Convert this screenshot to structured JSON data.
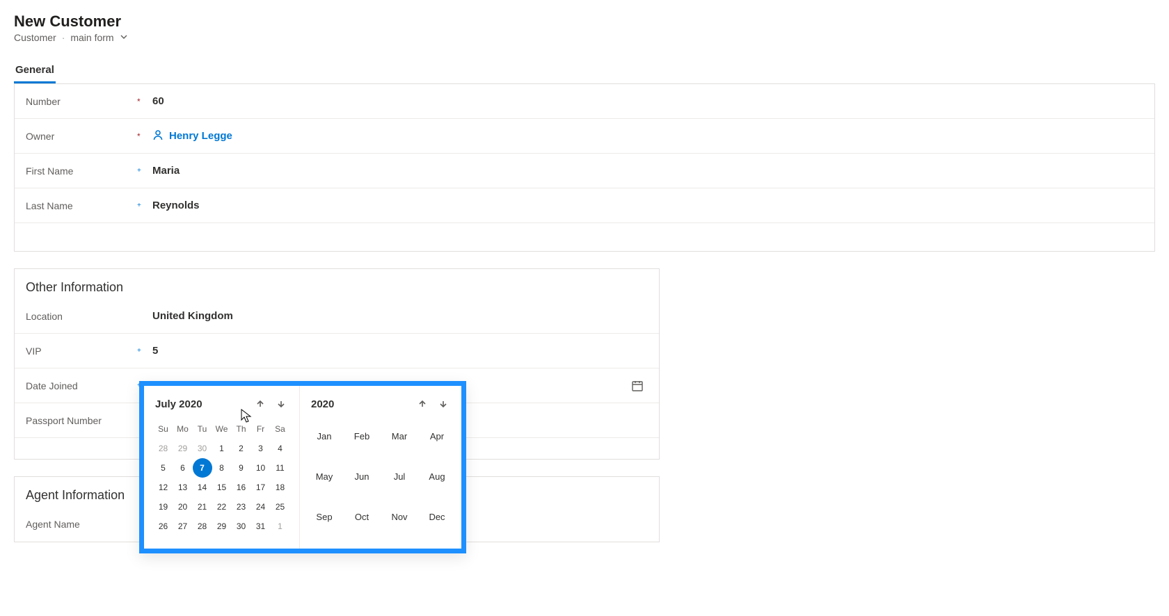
{
  "header": {
    "title": "New Customer",
    "entity": "Customer",
    "form_selector": "main form"
  },
  "tabs": [
    {
      "label": "General",
      "active": true
    }
  ],
  "general": {
    "number": {
      "label": "Number",
      "value": "60"
    },
    "owner": {
      "label": "Owner",
      "value": "Henry Legge"
    },
    "first_name": {
      "label": "First Name",
      "value": "Maria"
    },
    "last_name": {
      "label": "Last Name",
      "value": "Reynolds"
    }
  },
  "other_info": {
    "heading": "Other Information",
    "location": {
      "label": "Location",
      "value": "United Kingdom"
    },
    "vip": {
      "label": "VIP",
      "value": "5"
    },
    "date_joined": {
      "label": "Date Joined",
      "value": "---"
    },
    "passport_number": {
      "label": "Passport Number",
      "value": ""
    }
  },
  "agent_info": {
    "heading": "Agent Information",
    "agent_name": {
      "label": "Agent Name",
      "value": ""
    }
  },
  "datepicker": {
    "month_title": "July 2020",
    "year_title": "2020",
    "dows": [
      "Su",
      "Mo",
      "Tu",
      "We",
      "Th",
      "Fr",
      "Sa"
    ],
    "weeks": [
      [
        {
          "d": "28",
          "o": true
        },
        {
          "d": "29",
          "o": true
        },
        {
          "d": "30",
          "o": true
        },
        {
          "d": "1"
        },
        {
          "d": "2"
        },
        {
          "d": "3"
        },
        {
          "d": "4"
        }
      ],
      [
        {
          "d": "5"
        },
        {
          "d": "6"
        },
        {
          "d": "7",
          "sel": true
        },
        {
          "d": "8"
        },
        {
          "d": "9"
        },
        {
          "d": "10"
        },
        {
          "d": "11"
        }
      ],
      [
        {
          "d": "12"
        },
        {
          "d": "13"
        },
        {
          "d": "14"
        },
        {
          "d": "15"
        },
        {
          "d": "16"
        },
        {
          "d": "17"
        },
        {
          "d": "18"
        }
      ],
      [
        {
          "d": "19"
        },
        {
          "d": "20"
        },
        {
          "d": "21"
        },
        {
          "d": "22"
        },
        {
          "d": "23"
        },
        {
          "d": "24"
        },
        {
          "d": "25"
        }
      ],
      [
        {
          "d": "26"
        },
        {
          "d": "27"
        },
        {
          "d": "28"
        },
        {
          "d": "29"
        },
        {
          "d": "30"
        },
        {
          "d": "31"
        },
        {
          "d": "1",
          "o": true
        }
      ]
    ],
    "months": [
      "Jan",
      "Feb",
      "Mar",
      "Apr",
      "May",
      "Jun",
      "Jul",
      "Aug",
      "Sep",
      "Oct",
      "Nov",
      "Dec"
    ]
  }
}
